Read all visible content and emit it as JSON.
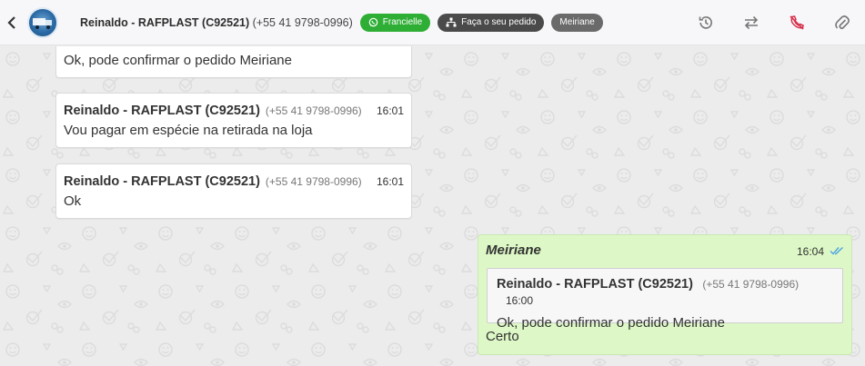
{
  "header": {
    "contact_name": "Reinaldo - RAFPLAST (C92521)",
    "contact_phone": "(+55 41 9798-0996)",
    "tags": [
      {
        "label": "Francielle",
        "color": "#2fae36",
        "icon": "whatsapp-icon"
      },
      {
        "label": "Faça o seu pedido",
        "color": "#4a4a4a",
        "icon": "sitemap-icon"
      },
      {
        "label": "Meiriane",
        "color": "#6a6a6a"
      }
    ],
    "actions": [
      "history-icon",
      "transfer-icon",
      "end-call-icon",
      "attach-icon"
    ]
  },
  "messages": [
    {
      "text": "Ok, pode confirmar o pedido Meiriane"
    },
    {
      "sender": "Reinaldo - RAFPLAST (C92521)",
      "phone": "(+55 41 9798-0996)",
      "time": "16:01",
      "text": "Vou pagar em espécie na retirada na loja"
    },
    {
      "sender": "Reinaldo - RAFPLAST (C92521)",
      "phone": "(+55 41 9798-0996)",
      "time": "16:01",
      "text": "Ok"
    }
  ],
  "outgoing": {
    "author": "Meiriane",
    "time": "16:04",
    "status": "read",
    "quoted": {
      "sender": "Reinaldo - RAFPLAST (C92521)",
      "phone": "(+55 41 9798-0996)",
      "time": "16:00",
      "text": "Ok, pode confirmar o pedido Meiriane"
    },
    "text": "Certo"
  },
  "colors": {
    "outgoing_bubble": "#ddf8c6",
    "read_check": "#4fa3e0",
    "end_call": "#d62f4a"
  }
}
